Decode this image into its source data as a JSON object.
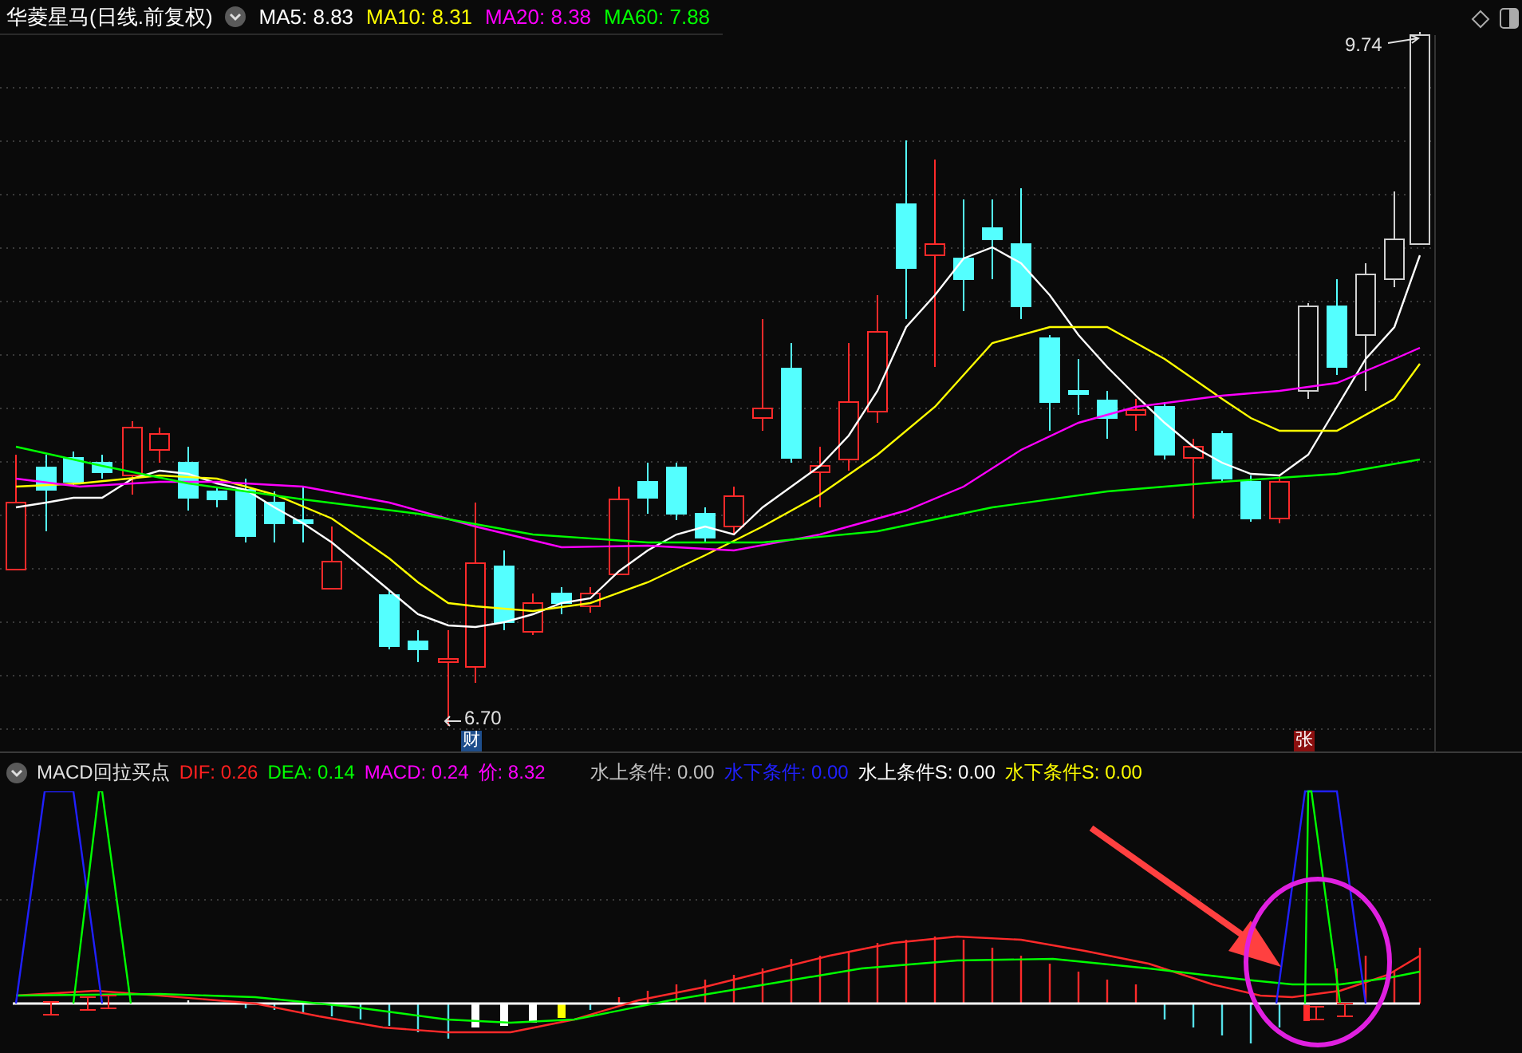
{
  "main_chart": {
    "title": "华菱星马(日线.前复权)",
    "ma_readings": [
      {
        "label": "MA5: 8.83",
        "color": "#ffffff"
      },
      {
        "label": "MA10: 8.31",
        "color": "#ffff00"
      },
      {
        "label": "MA20: 8.38",
        "color": "#ff00ff"
      },
      {
        "label": "MA60: 7.88",
        "color": "#00ff00"
      }
    ],
    "high_label": "9.74",
    "low_label": "6.70",
    "event_markers": [
      {
        "label": "财",
        "color": "#1e4e8c"
      },
      {
        "label": "张",
        "color": "#8b0f0f"
      }
    ]
  },
  "indicator": {
    "title": "MACD回拉买点",
    "readings": [
      {
        "label": "DIF: 0.26",
        "color": "#ff2020"
      },
      {
        "label": "DEA: 0.14",
        "color": "#00ff00"
      },
      {
        "label": "MACD: 0.24",
        "color": "#ff00ff"
      },
      {
        "label": "价: 8.32",
        "color": "#ff00ff"
      },
      {
        "label": "水上条件: 0.00",
        "color": "#c0c0c0"
      },
      {
        "label": "水下条件: 0.00",
        "color": "#2020ff"
      },
      {
        "label": "水上条件S: 0.00",
        "color": "#ffffff"
      },
      {
        "label": "水下条件S: 0.00",
        "color": "#ffff00"
      }
    ]
  }
}
